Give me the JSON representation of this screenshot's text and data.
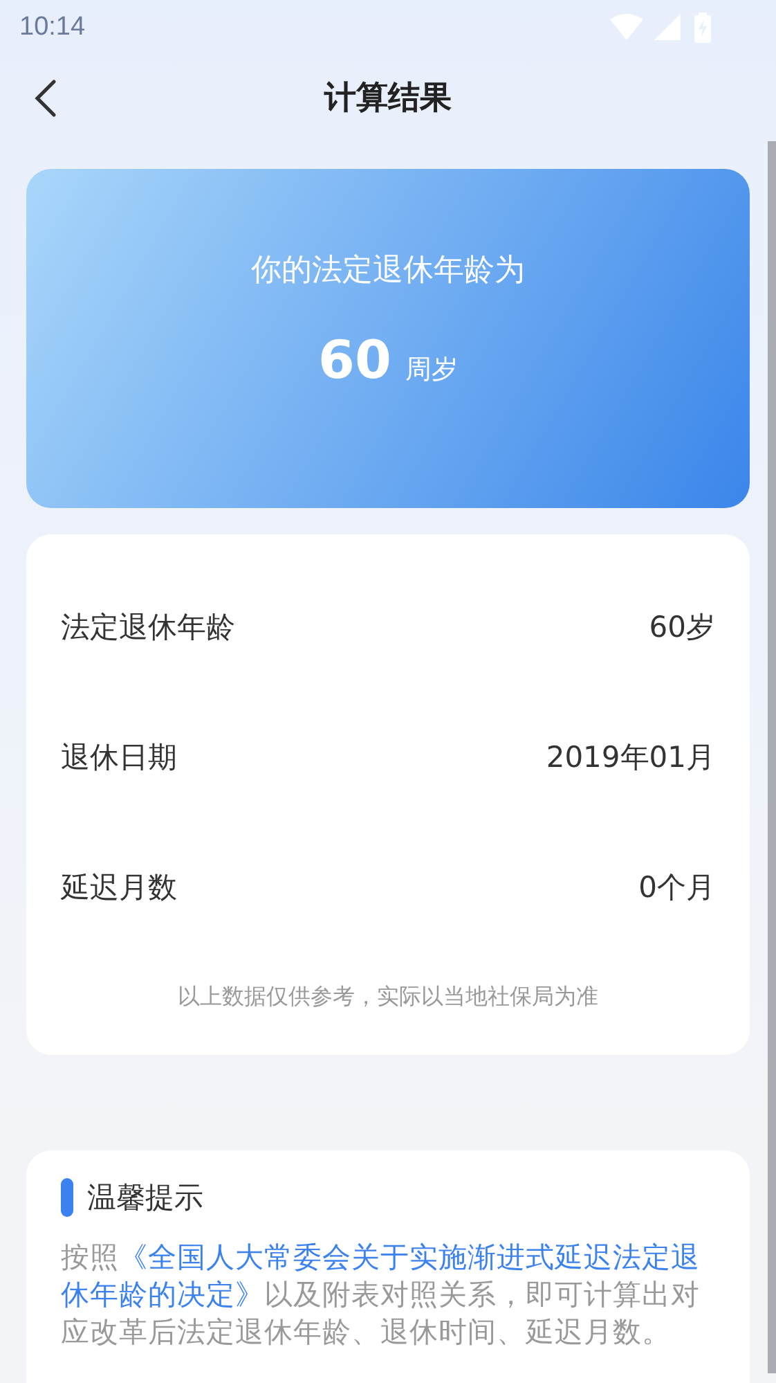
{
  "status_bar": {
    "time": "10:14"
  },
  "header": {
    "title": "计算结果"
  },
  "hero": {
    "caption": "你的法定退休年龄为",
    "value": "60",
    "unit": "周岁"
  },
  "details": {
    "rows": [
      {
        "label": "法定退休年龄",
        "value": "60岁"
      },
      {
        "label": "退休日期",
        "value": "2019年01月"
      },
      {
        "label": "延迟月数",
        "value": "0个月"
      }
    ],
    "note": "以上数据仅供参考，实际以当地社保局为准"
  },
  "tip": {
    "heading": "温馨提示",
    "before": "按照",
    "highlight": "《全国人大常委会关于实施渐进式延迟法定退休年龄的决定》",
    "after": "以及附表对照关系，即可计算出对应改革后法定退休年龄、退休时间、延迟月数。"
  }
}
